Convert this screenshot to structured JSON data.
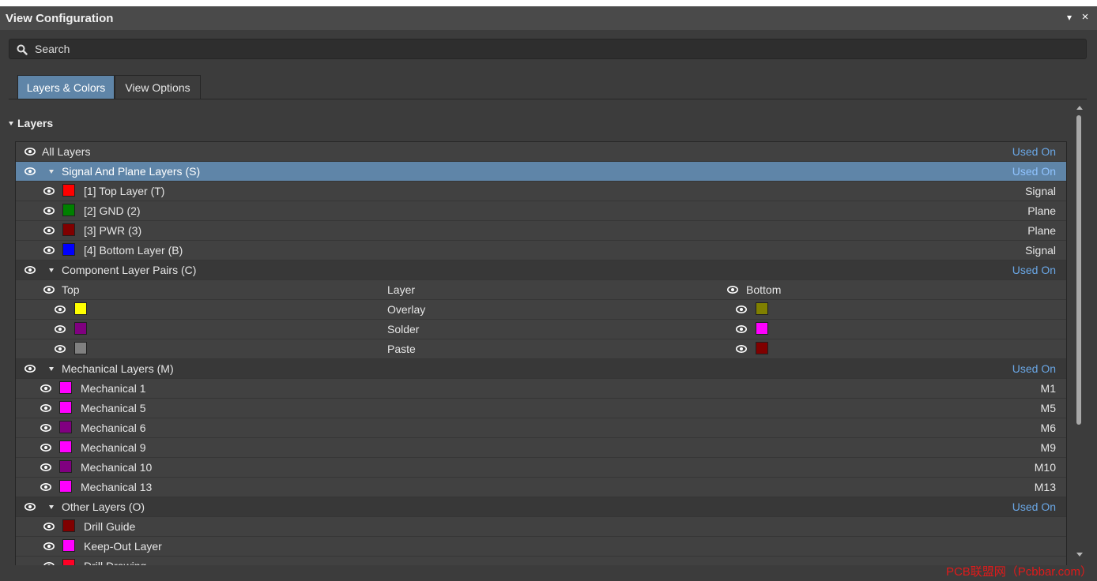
{
  "window": {
    "title": "View Configuration",
    "menu_glyph": "▾",
    "close_glyph": "×"
  },
  "search": {
    "placeholder": "Search",
    "value": ""
  },
  "tabs": [
    {
      "label": "Layers & Colors",
      "active": true
    },
    {
      "label": "View Options",
      "active": false
    }
  ],
  "section": {
    "title": "Layers"
  },
  "layers": {
    "all_layers": {
      "label": "All Layers",
      "used_on": "Used On"
    },
    "signal_plane": {
      "label": "Signal And Plane Layers (S)",
      "used_on": "Used On",
      "items": [
        {
          "label": "[1] Top Layer (T)",
          "color": "#ff0000",
          "type": "Signal"
        },
        {
          "label": "[2] GND (2)",
          "color": "#008000",
          "type": "Plane"
        },
        {
          "label": "[3] PWR (3)",
          "color": "#800000",
          "type": "Plane"
        },
        {
          "label": "[4] Bottom Layer (B)",
          "color": "#0000ff",
          "type": "Signal"
        }
      ]
    },
    "component_pairs": {
      "label": "Component Layer Pairs (C)",
      "used_on": "Used On",
      "header": {
        "top": "Top",
        "layer": "Layer",
        "bottom": "Bottom"
      },
      "items": [
        {
          "layer": "Overlay",
          "top_color": "#ffff00",
          "bottom_color": "#808000"
        },
        {
          "layer": "Solder",
          "top_color": "#800080",
          "bottom_color": "#ff00ff"
        },
        {
          "layer": "Paste",
          "top_color": "#808080",
          "bottom_color": "#800000"
        }
      ]
    },
    "mechanical": {
      "label": "Mechanical Layers (M)",
      "used_on": "Used On",
      "items": [
        {
          "label": "Mechanical 1",
          "color": "#ff00ff",
          "code": "M1"
        },
        {
          "label": "Mechanical 5",
          "color": "#ff00ff",
          "code": "M5"
        },
        {
          "label": "Mechanical 6",
          "color": "#800080",
          "code": "M6"
        },
        {
          "label": "Mechanical 9",
          "color": "#ff00ff",
          "code": "M9"
        },
        {
          "label": "Mechanical 10",
          "color": "#800080",
          "code": "M10"
        },
        {
          "label": "Mechanical 13",
          "color": "#ff00ff",
          "code": "M13"
        }
      ]
    },
    "other": {
      "label": "Other Layers (O)",
      "used_on": "Used On",
      "items": [
        {
          "label": "Drill Guide",
          "color": "#800000"
        },
        {
          "label": "Keep-Out Layer",
          "color": "#ff00ff"
        },
        {
          "label": "Drill Drawing",
          "color": "#ff0026"
        }
      ]
    }
  },
  "colors": {
    "accent": "#5f85a8",
    "link": "#6aa7e6",
    "panel_bg": "#3c3c3c"
  },
  "watermark": {
    "text": "PCB联盟网（Pcbbar.com）"
  }
}
